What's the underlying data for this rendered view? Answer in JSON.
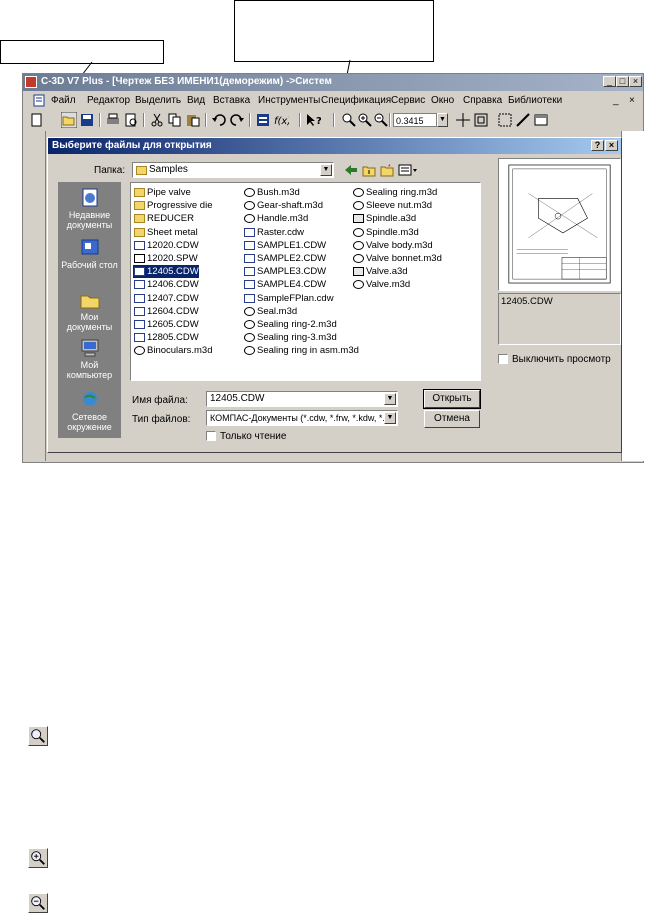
{
  "app": {
    "title": "С-3D V7 Plus - [Чертеж БЕЗ ИМЕНИ1(деморежим) ->Систем",
    "menu": [
      "Файл",
      "Редактор",
      "Выделить",
      "Вид",
      "Вставка",
      "Инструменты",
      "Спецификация",
      "Сервис",
      "Окно",
      "Справка",
      "Библиотеки"
    ],
    "zoom_value": "0.3415",
    "window_controls": {
      "minimize": "_",
      "restore": "□",
      "close": "×"
    }
  },
  "dialog": {
    "title": "Выберите файлы для открытия",
    "help": "?",
    "close": "×",
    "folder_label": "Папка:",
    "folder_value": "Samples",
    "places": [
      {
        "label": "Недавние документы",
        "icon": "recent-documents-icon"
      },
      {
        "label": "Рабочий стол",
        "icon": "desktop-icon"
      },
      {
        "label": "Мои документы",
        "icon": "my-documents-icon"
      },
      {
        "label": "Мой компьютер",
        "icon": "my-computer-icon"
      },
      {
        "label": "Сетевое окружение",
        "icon": "network-icon"
      }
    ],
    "files_col1": [
      {
        "name": "Pipe valve",
        "type": "folder"
      },
      {
        "name": "Progressive die",
        "type": "folder"
      },
      {
        "name": "REDUCER",
        "type": "folder"
      },
      {
        "name": "Sheet metal",
        "type": "folder"
      },
      {
        "name": "12020.CDW",
        "type": "cdw"
      },
      {
        "name": "12020.SPW",
        "type": "spw"
      },
      {
        "name": "12405.CDW",
        "type": "cdw",
        "selected": true
      },
      {
        "name": "12406.CDW",
        "type": "cdw"
      },
      {
        "name": "12407.CDW",
        "type": "cdw"
      },
      {
        "name": "12604.CDW",
        "type": "cdw"
      },
      {
        "name": "12605.CDW",
        "type": "cdw"
      },
      {
        "name": "12805.CDW",
        "type": "cdw"
      },
      {
        "name": "Binoculars.m3d",
        "type": "m3d"
      }
    ],
    "files_col2": [
      {
        "name": "Bush.m3d",
        "type": "m3d"
      },
      {
        "name": "Gear-shaft.m3d",
        "type": "m3d"
      },
      {
        "name": "Handle.m3d",
        "type": "m3d"
      },
      {
        "name": "Raster.cdw",
        "type": "cdw"
      },
      {
        "name": "SAMPLE1.CDW",
        "type": "cdw"
      },
      {
        "name": "SAMPLE2.CDW",
        "type": "cdw"
      },
      {
        "name": "SAMPLE3.CDW",
        "type": "cdw"
      },
      {
        "name": "SAMPLE4.CDW",
        "type": "cdw"
      },
      {
        "name": "SampleFPlan.cdw",
        "type": "cdw"
      },
      {
        "name": "Seal.m3d",
        "type": "m3d"
      },
      {
        "name": "Sealing ring-2.m3d",
        "type": "m3d"
      },
      {
        "name": "Sealing ring-3.m3d",
        "type": "m3d"
      },
      {
        "name": "Sealing ring in asm.m3d",
        "type": "m3d"
      }
    ],
    "files_col3": [
      {
        "name": "Sealing ring.m3d",
        "type": "m3d"
      },
      {
        "name": "Sleeve nut.m3d",
        "type": "m3d"
      },
      {
        "name": "Spindle.a3d",
        "type": "a3d"
      },
      {
        "name": "Spindle.m3d",
        "type": "m3d"
      },
      {
        "name": "Valve body.m3d",
        "type": "m3d"
      },
      {
        "name": "Valve bonnet.m3d",
        "type": "m3d"
      },
      {
        "name": "Valve.a3d",
        "type": "a3d"
      },
      {
        "name": "Valve.m3d",
        "type": "m3d"
      }
    ],
    "filename_label": "Имя файла:",
    "filename_value": "12405.CDW",
    "filetype_label": "Тип файлов:",
    "filetype_value": "КОМПАС-Документы (*.cdw, *.frw, *.kdw, *.sp",
    "readonly_label": "Только чтение",
    "open_button": "Открыть",
    "cancel_button": "Отмена",
    "preview_filename": "12405.CDW",
    "disable_preview_label": "Выключить просмотр"
  }
}
